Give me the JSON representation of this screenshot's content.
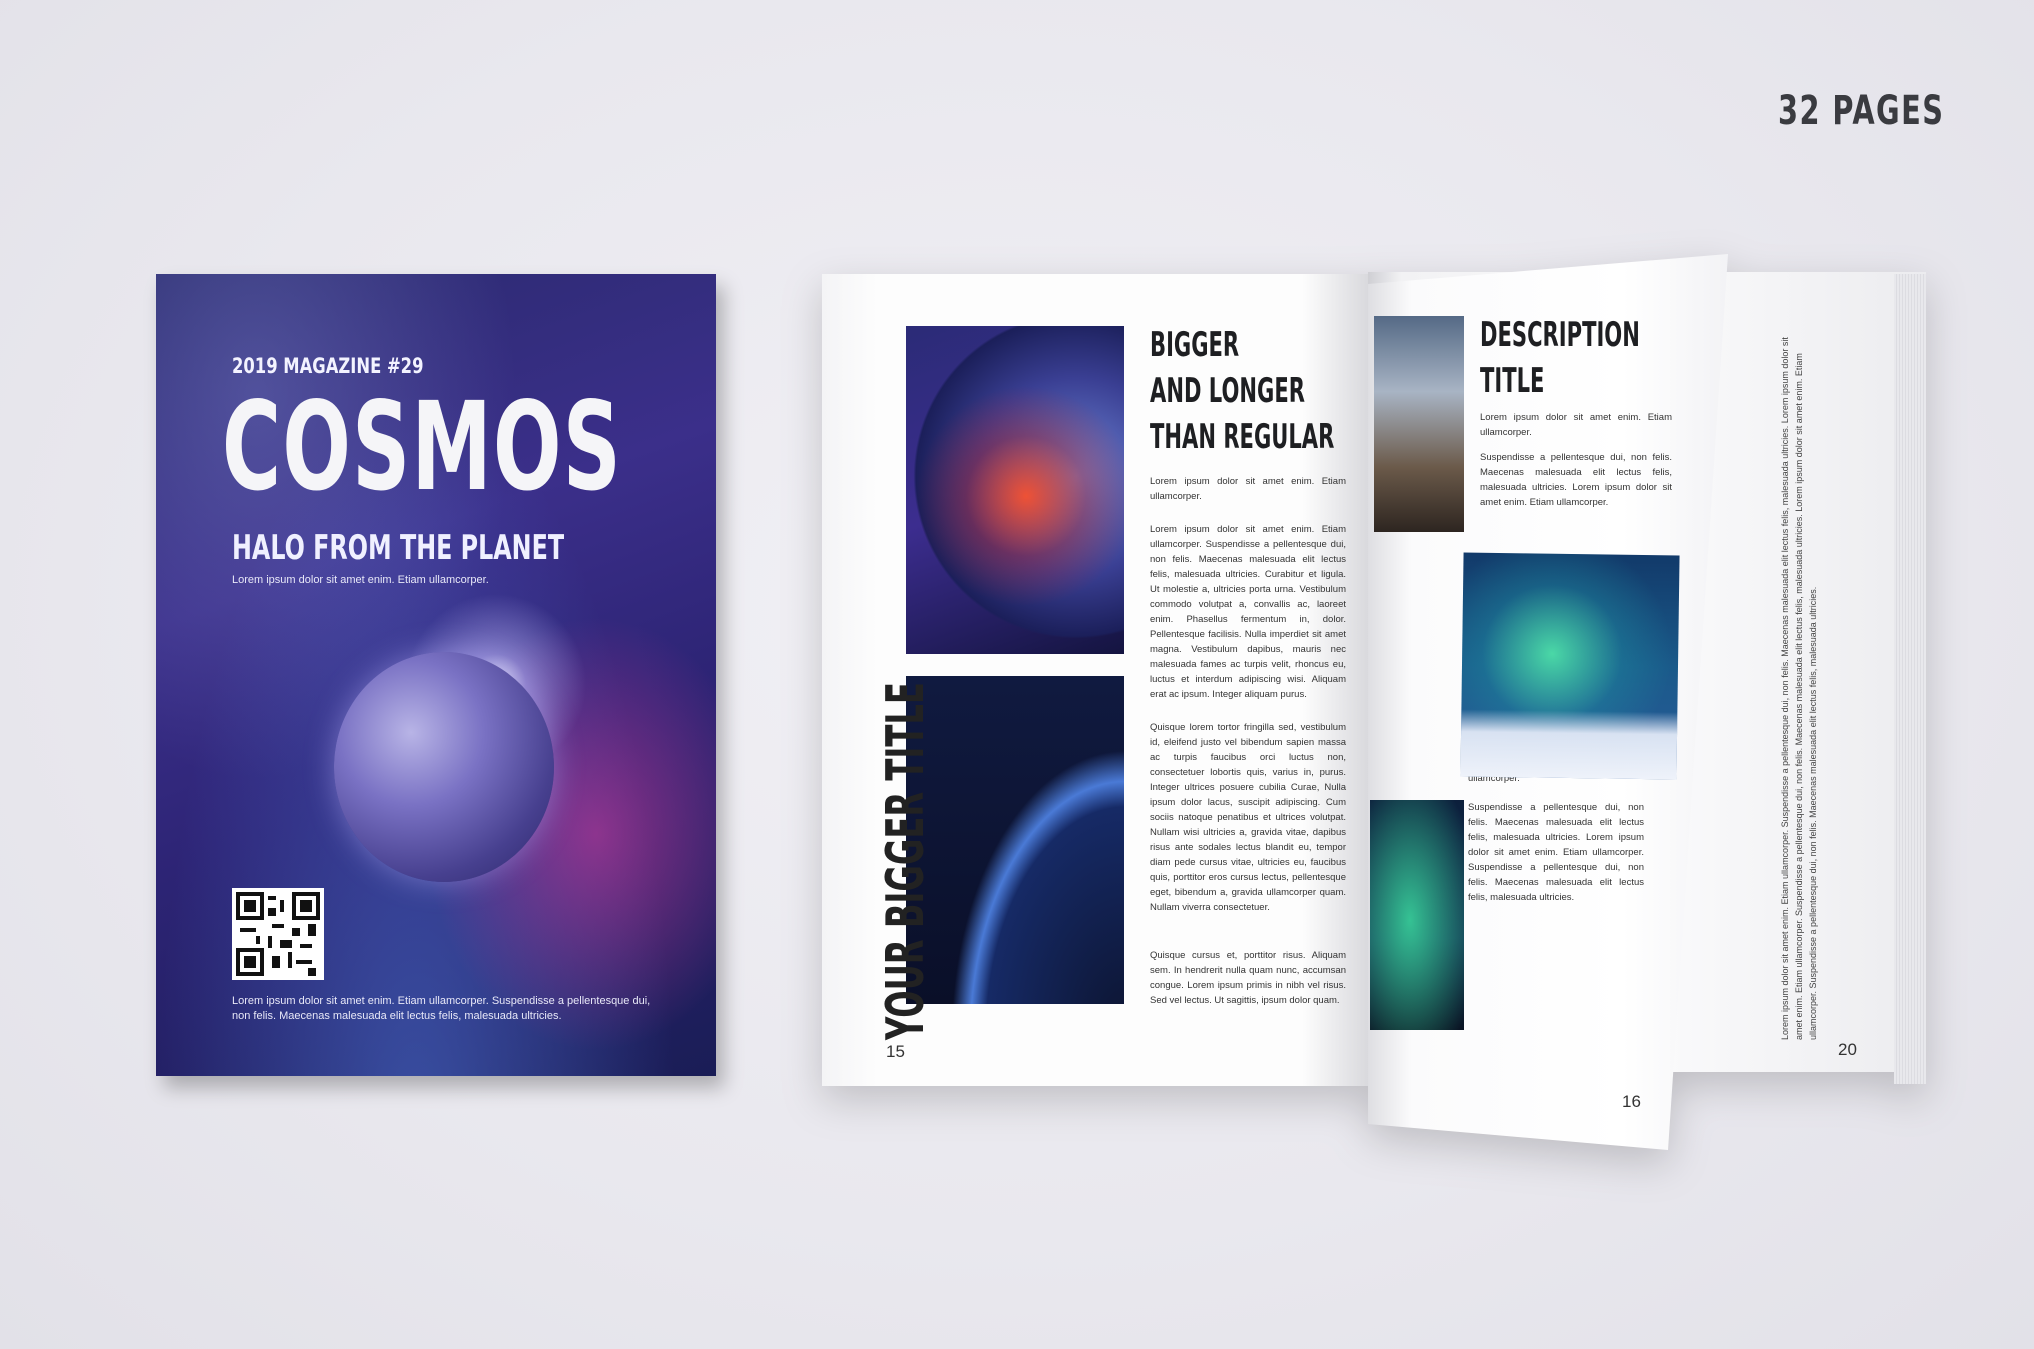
{
  "badge": {
    "pages": "32 PAGES"
  },
  "cover": {
    "issue": "2019 MAGAZINE  #29",
    "title": "COSMOS",
    "subtitle": "HALO FROM THE PLANET",
    "tagline": "Lorem ipsum dolor sit amet enim. Etiam ullamcorper.",
    "footer": "Lorem ipsum dolor sit amet enim. Etiam ullamcorper. Suspendisse a pellentesque dui, non felis. Maecenas malesuada elit lectus felis, malesuada ultricies."
  },
  "page15": {
    "heading": [
      "BIGGER",
      "AND LONGER",
      "THAN REGULAR"
    ],
    "intro": "Lorem ipsum dolor sit amet enim. Etiam ullamcorper.",
    "body1": "Lorem ipsum dolor sit amet enim. Etiam ullamcorper. Suspendisse a pellentesque dui, non felis. Maecenas malesuada elit lectus felis, malesuada ultricies. Curabitur et ligula. Ut molestie a, ultricies porta urna. Vestibulum commodo volutpat a, convallis ac, laoreet enim. Phasellus fermentum in, dolor. Pellentesque facilisis. Nulla imperdiet sit amet magna. Vestibulum dapibus, mauris nec malesuada fames ac turpis velit, rhoncus eu, luctus et interdum adipiscing wisi. Aliquam erat ac ipsum. Integer aliquam purus.",
    "body2": "Quisque lorem tortor fringilla sed, vestibulum id, eleifend justo vel bibendum sapien massa ac turpis faucibus orci luctus non, consectetuer lobortis quis, varius in, purus. Integer ultrices posuere cubilia Curae, Nulla ipsum dolor lacus, suscipit adipiscing. Cum sociis natoque penatibus et ultrices volutpat. Nullam wisi ultricies a, gravida vitae, dapibus risus ante sodales lectus blandit eu, tempor diam pede cursus vitae, ultricies eu, faucibus quis, porttitor eros cursus lectus, pellentesque eget, bibendum a, gravida ullamcorper quam. Nullam viverra consectetuer.",
    "body3": "Quisque cursus et, porttitor risus. Aliquam sem. In hendrerit nulla quam nunc, accumsan congue. Lorem ipsum primis in nibh vel risus. Sed vel lectus. Ut sagittis, ipsum dolor quam.",
    "page_number": "15"
  },
  "page16": {
    "heading": [
      "DESCRIPTION",
      "TITLE"
    ],
    "intro": "Lorem ipsum dolor sit amet enim. Etiam ullamcorper.",
    "body1": "Suspendisse a pellentesque dui, non felis. Maecenas malesuada elit lectus felis, malesuada ultricies. Lorem ipsum dolor sit amet enim. Etiam ullamcorper.",
    "intro2": "Lorem ipsum dolor sit amet enim. Etiam ullamcorper.",
    "body2": "Suspendisse a pellentesque dui, non felis. Maecenas malesuada elit lectus felis, malesuada ultricies. Lorem ipsum dolor sit amet enim. Etiam ullamcorper. Suspendisse a pellentesque dui, non felis. Maecenas malesuada elit lectus felis, malesuada ultricies.",
    "page_number": "16"
  },
  "page20": {
    "title": "YOUR BIGGER TITLE",
    "body": "Lorem ipsum dolor sit amet enim. Etiam ullamcorper. Suspendisse a pellentesque dui, non felis. Maecenas malesuada elit lectus felis, malesuada ultricies. Lorem ipsum dolor sit amet enim. Etiam ullamcorper. Suspendisse a pellentesque dui, non felis. Maecenas malesuada elit lectus felis, malesuada ultricies. Lorem ipsum dolor sit amet enim. Etiam ullamcorper. Suspendisse a pellentesque dui, non felis. Maecenas malesuada elit lectus felis, malesuada ultricies.",
    "page_number": "20"
  }
}
